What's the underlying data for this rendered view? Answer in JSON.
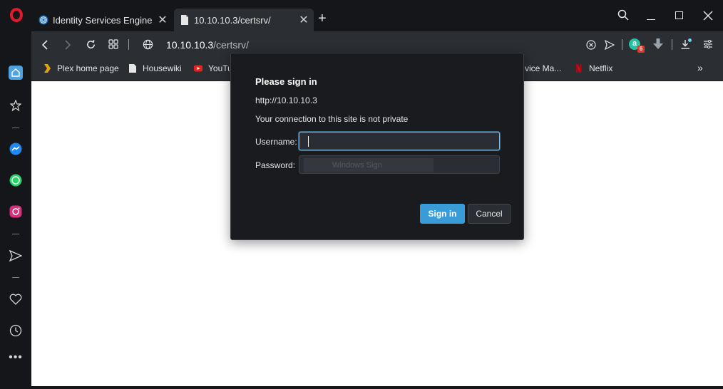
{
  "browser": {
    "tabs": [
      {
        "label": "Identity Services Engine",
        "active": false
      },
      {
        "label": "10.10.10.3/certsrv/",
        "active": true
      }
    ],
    "new_tab_label": "+",
    "address": {
      "host": "10.10.10.3",
      "path": "/certsrv/"
    },
    "bookmarks": [
      {
        "label": "Plex home page"
      },
      {
        "label": "Housewiki"
      },
      {
        "label": "YouTu"
      },
      {
        "label": "vice Ma..."
      },
      {
        "label": "Netflix"
      }
    ],
    "bookmarks_more": "»",
    "extension_badge": "6",
    "colors": {
      "chrome_dark": "#151619",
      "toolbar": "#2b2e33",
      "accent": "#3a9bd9",
      "opera_red": "#e01a2a"
    }
  },
  "dialog": {
    "title": "Please sign in",
    "origin": "http://10.10.10.3",
    "warning": "Your connection to this site is not private",
    "username_label": "Username:",
    "username_value": "",
    "password_label": "Password:",
    "password_autofill_hint": "Windows Sign",
    "sign_in_label": "Sign in",
    "cancel_label": "Cancel"
  }
}
